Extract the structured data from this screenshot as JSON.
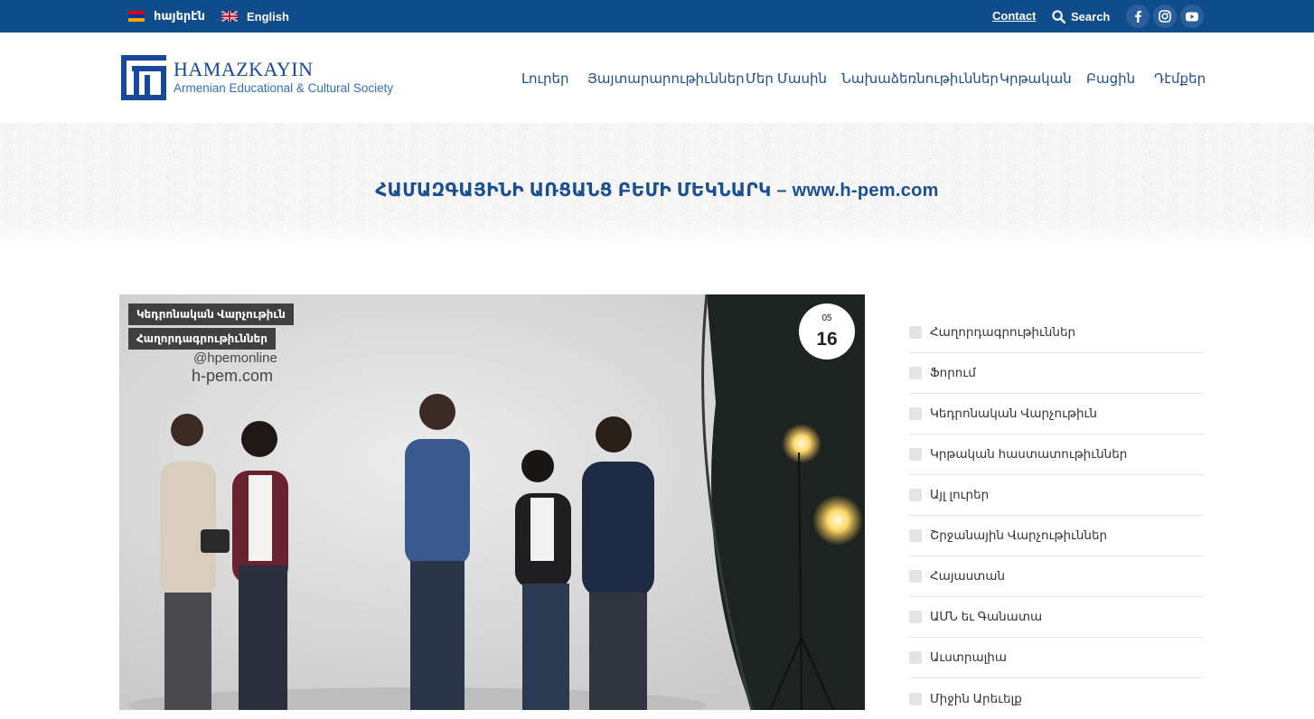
{
  "topbar": {
    "lang_hy": "հայերէն",
    "lang_en": "English",
    "contact": "Contact",
    "search": "Search",
    "social_icons": [
      "facebook-icon",
      "instagram-icon",
      "youtube-icon"
    ],
    "bg_color": "#0f4c8b"
  },
  "logo": {
    "name": "HAMAZKAYIN",
    "subtitle": "Armenian Educational & Cultural Society"
  },
  "nav": {
    "items": [
      {
        "label": "Լուրեր"
      },
      {
        "label": "Յայտարարութիւններ"
      },
      {
        "label": "Մեր Մասին"
      },
      {
        "label": "Նախաձեռնութիւններ"
      },
      {
        "label": "Կրթական"
      },
      {
        "label": "Բացին"
      },
      {
        "label": "Դէմքեր"
      }
    ]
  },
  "page": {
    "title": "ՀԱՄԱԶԳԱՅԻՆԻ ԱՌՑԱՆՑ ԲԵՄԻ ՄԵԿՆԱՐԿ – www.h-pem.com"
  },
  "post": {
    "categories": [
      "Կեդրոնական Վարչութիւն",
      "Հաղորդագրութիւններ"
    ],
    "date_month": "05",
    "date_day": "16",
    "watermark_handle": "@hpemonline",
    "watermark_site": "h-pem.com"
  },
  "sidebar": {
    "items": [
      {
        "label": "Հաղորդագրութիւններ"
      },
      {
        "label": "Ֆորում"
      },
      {
        "label": "Կեդրոնական Վարչութիւն"
      },
      {
        "label": "Կրթական հաստատութիւններ"
      },
      {
        "label": "Այլ լուրեր"
      },
      {
        "label": "Շրջանային Վարչութիւններ"
      },
      {
        "label": "Հայաստան"
      },
      {
        "label": "ԱՄՆ եւ Գանատա"
      },
      {
        "label": "Աւստրալիա"
      },
      {
        "label": "Միջին Արեւելք"
      }
    ]
  },
  "colors": {
    "brand_blue": "#0f4c8b",
    "nav_text": "#1d4f90",
    "title_text": "#1a4f91"
  }
}
